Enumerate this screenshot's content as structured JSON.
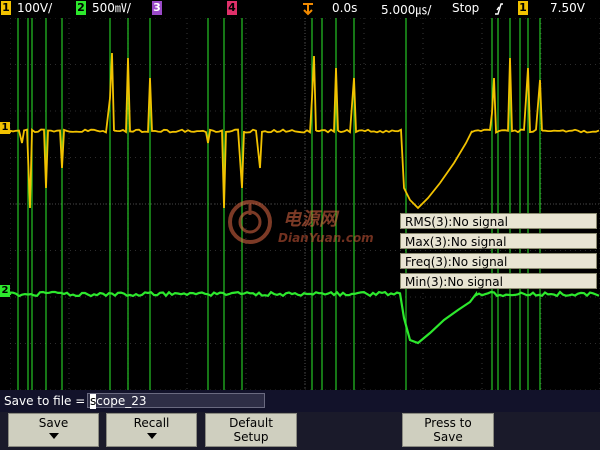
{
  "topbar": {
    "ch1": {
      "num": "1",
      "scale": "100V/"
    },
    "ch2": {
      "num": "2",
      "scale": "500㎷/"
    },
    "ch3": {
      "num": "3"
    },
    "ch4": {
      "num": "4"
    },
    "time_offset": "0.0s",
    "timebase": "5.000㎲/",
    "run_state": "Stop",
    "trigger_slope_icon": "rising-edge-icon",
    "trigger_source": "1",
    "trigger_level": "7.50V"
  },
  "markers": {
    "ch1": "1",
    "ch2": "2"
  },
  "measurements": [
    {
      "label": "RMS(3):No signal"
    },
    {
      "label": "Max(3):No signal"
    },
    {
      "label": "Freq(3):No signal"
    },
    {
      "label": "Min(3):No signal"
    }
  ],
  "watermark": {
    "cn": "电源网",
    "en": "DianYuan.com"
  },
  "save": {
    "label": "Save to file =",
    "first_char": "s",
    "rest": "cope_23"
  },
  "softkeys": {
    "save": "Save",
    "recall": "Recall",
    "default_line1": "Default",
    "default_line2": "Setup",
    "press_line1": "Press to",
    "press_line2": "Save"
  },
  "colors": {
    "ch1": "#f2c200",
    "ch2": "#2de82d",
    "ch3": "#9a4ac8",
    "ch4": "#e0306a",
    "grid": "#5a5a5a"
  }
}
